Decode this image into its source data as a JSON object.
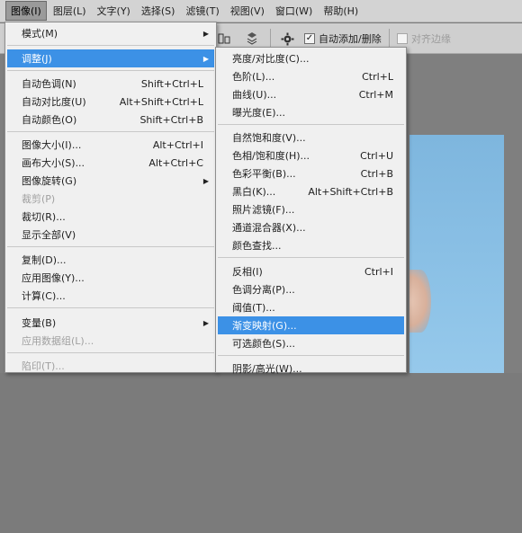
{
  "menubar": {
    "items": [
      "图像(I)",
      "图层(L)",
      "文字(Y)",
      "选择(S)",
      "滤镜(T)",
      "视图(V)",
      "窗口(W)",
      "帮助(H)"
    ]
  },
  "options": {
    "auto_add_delete": "自动添加/删除",
    "align_edges": "对齐边缘"
  },
  "image_menu": {
    "items": [
      {
        "label": "模式(M)",
        "shortcut": ""
      },
      {
        "label": "调整(J)",
        "shortcut": ""
      },
      {
        "label": "自动色调(N)",
        "shortcut": "Shift+Ctrl+L"
      },
      {
        "label": "自动对比度(U)",
        "shortcut": "Alt+Shift+Ctrl+L"
      },
      {
        "label": "自动颜色(O)",
        "shortcut": "Shift+Ctrl+B"
      },
      {
        "label": "图像大小(I)...",
        "shortcut": "Alt+Ctrl+I"
      },
      {
        "label": "画布大小(S)...",
        "shortcut": "Alt+Ctrl+C"
      },
      {
        "label": "图像旋转(G)",
        "shortcut": ""
      },
      {
        "label": "裁剪(P)",
        "shortcut": ""
      },
      {
        "label": "裁切(R)...",
        "shortcut": ""
      },
      {
        "label": "显示全部(V)",
        "shortcut": ""
      },
      {
        "label": "复制(D)...",
        "shortcut": ""
      },
      {
        "label": "应用图像(Y)...",
        "shortcut": ""
      },
      {
        "label": "计算(C)...",
        "shortcut": ""
      },
      {
        "label": "变量(B)",
        "shortcut": ""
      },
      {
        "label": "应用数据组(L)...",
        "shortcut": ""
      },
      {
        "label": "陷印(T)...",
        "shortcut": ""
      }
    ]
  },
  "adjust_menu": {
    "items": [
      {
        "label": "亮度/对比度(C)...",
        "shortcut": ""
      },
      {
        "label": "色阶(L)...",
        "shortcut": "Ctrl+L"
      },
      {
        "label": "曲线(U)...",
        "shortcut": "Ctrl+M"
      },
      {
        "label": "曝光度(E)...",
        "shortcut": ""
      },
      {
        "label": "自然饱和度(V)...",
        "shortcut": ""
      },
      {
        "label": "色相/饱和度(H)...",
        "shortcut": "Ctrl+U"
      },
      {
        "label": "色彩平衡(B)...",
        "shortcut": "Ctrl+B"
      },
      {
        "label": "黑白(K)...",
        "shortcut": "Alt+Shift+Ctrl+B"
      },
      {
        "label": "照片滤镜(F)...",
        "shortcut": ""
      },
      {
        "label": "通道混合器(X)...",
        "shortcut": ""
      },
      {
        "label": "颜色查找...",
        "shortcut": ""
      },
      {
        "label": "反相(I)",
        "shortcut": "Ctrl+I"
      },
      {
        "label": "色调分离(P)...",
        "shortcut": ""
      },
      {
        "label": "阈值(T)...",
        "shortcut": ""
      },
      {
        "label": "渐变映射(G)...",
        "shortcut": ""
      },
      {
        "label": "可选颜色(S)...",
        "shortcut": ""
      },
      {
        "label": "阴影/高光(W)...",
        "shortcut": ""
      }
    ]
  },
  "colors": {
    "highlight": "#3c91e6",
    "canvas_blue": "#8fc4e8"
  }
}
